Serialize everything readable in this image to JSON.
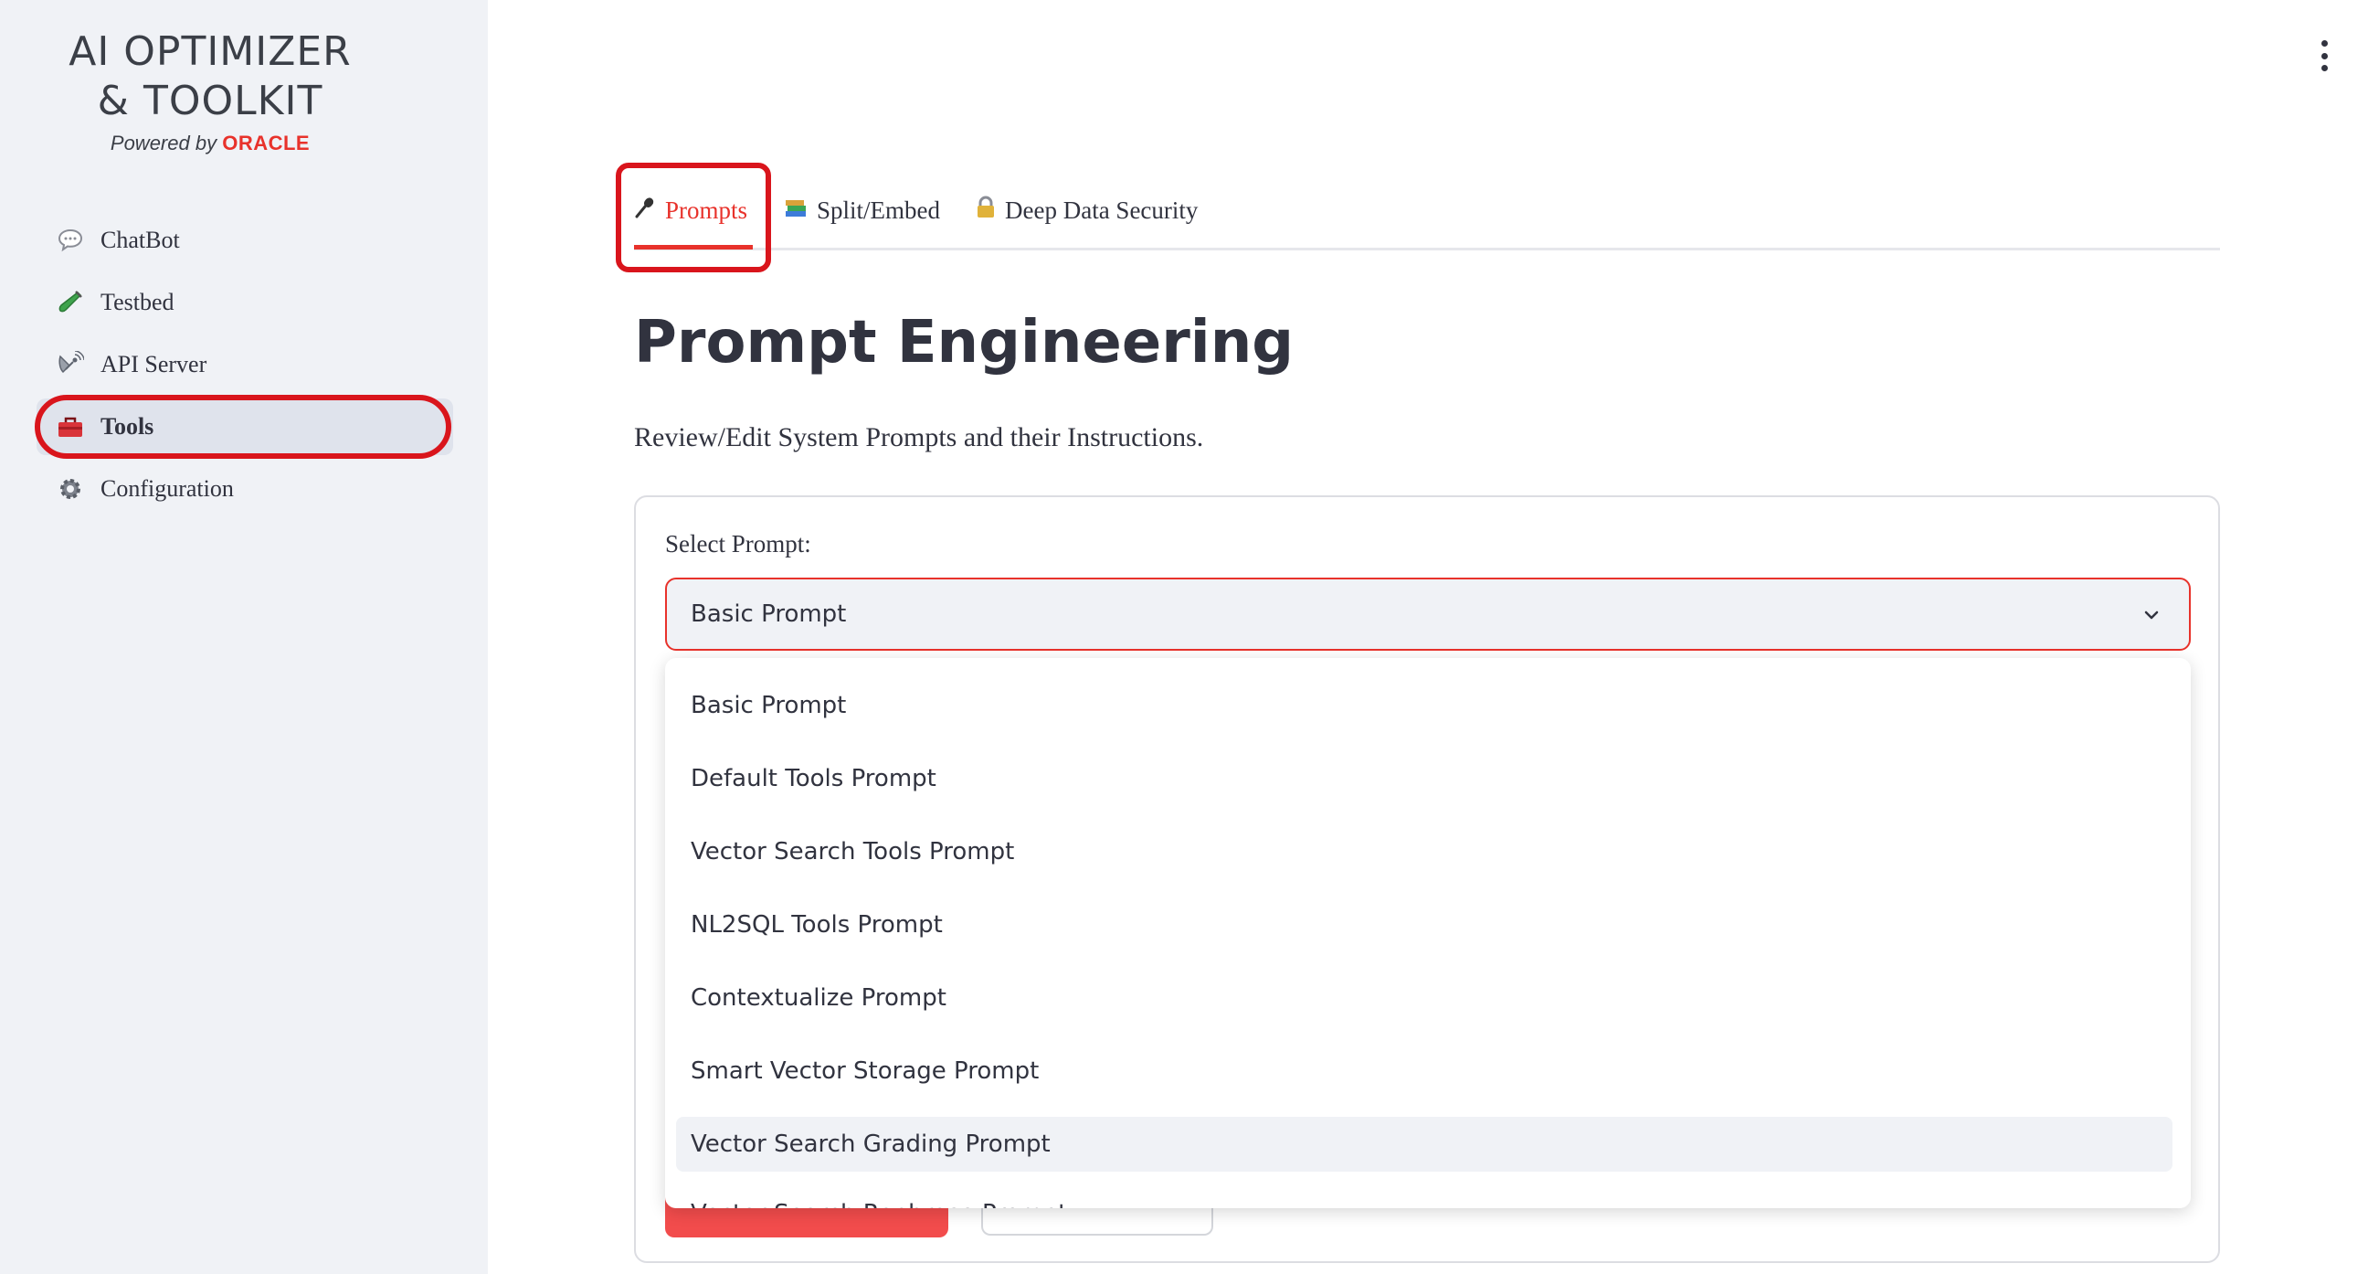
{
  "app": {
    "logo_line1": "AI OPTIMIZER",
    "logo_line2": "& TOOLKIT",
    "powered_by": "Powered by",
    "brand": "ORACLE"
  },
  "sidebar": {
    "items": [
      {
        "label": "ChatBot",
        "icon": "speech-bubble-icon"
      },
      {
        "label": "Testbed",
        "icon": "test-tube-icon"
      },
      {
        "label": "API Server",
        "icon": "satellite-icon"
      },
      {
        "label": "Tools",
        "icon": "toolbox-icon",
        "active": true
      },
      {
        "label": "Configuration",
        "icon": "gear-icon"
      }
    ]
  },
  "tabs": [
    {
      "label": "Prompts",
      "icon": "microphone-icon",
      "active": true
    },
    {
      "label": "Split/Embed",
      "icon": "books-icon"
    },
    {
      "label": "Deep Data Security",
      "icon": "lock-icon"
    }
  ],
  "page": {
    "title": "Prompt Engineering",
    "subtitle": "Review/Edit System Prompts and their Instructions."
  },
  "select": {
    "label": "Select Prompt:",
    "value": "Basic Prompt",
    "options": [
      "Basic Prompt",
      "Default Tools Prompt",
      "Vector Search Tools Prompt",
      "NL2SQL Tools Prompt",
      "Contextualize Prompt",
      "Smart Vector Storage Prompt",
      "Vector Search Grading Prompt",
      "Vector Search Rephrase Prompt"
    ],
    "hovered_option": "Vector Search Grading Prompt"
  },
  "colors": {
    "accent": "#e8322b",
    "highlight_outline": "#d9151c",
    "sidebar_bg": "#f0f2f6",
    "text": "#31333f"
  }
}
